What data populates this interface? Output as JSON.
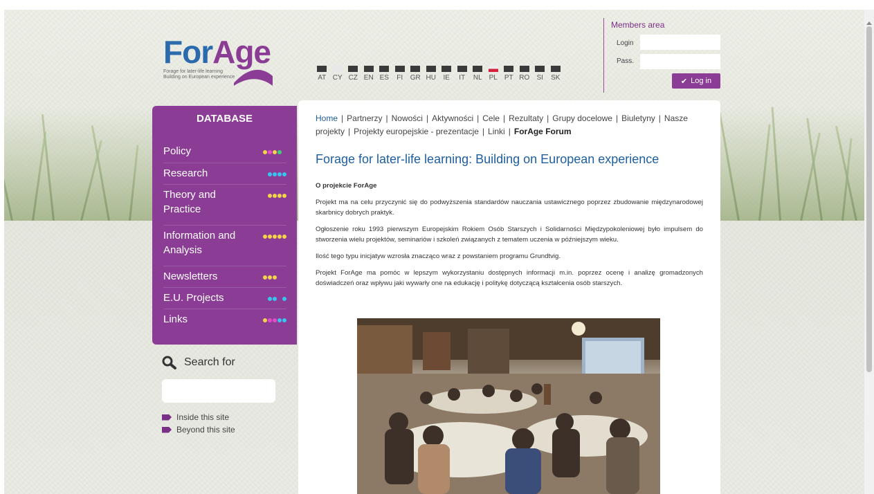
{
  "logo": {
    "part1": "For",
    "part2": "Age",
    "tagline1": "Forage for later-life learning",
    "tagline2": "Building on European experience"
  },
  "languages": [
    "AT",
    "CY",
    "CZ",
    "EN",
    "ES",
    "FI",
    "GR",
    "HU",
    "IE",
    "IT",
    "NL",
    "PL",
    "PT",
    "RO",
    "SI",
    "SK"
  ],
  "members": {
    "title": "Members area",
    "login_label": "Login",
    "pass_label": "Pass.",
    "button": "Log in"
  },
  "database": {
    "title": "DATABASE",
    "items": [
      {
        "label": "Policy",
        "dots": [
          "#f4d44a",
          "#e54bc8",
          "#f4d44a",
          "#39d27a",
          "#8b3d96"
        ]
      },
      {
        "label": "Research",
        "dots": [
          "#8b3d96",
          "#38c6f0",
          "#38c6f0",
          "#38c6f0",
          "#38c6f0"
        ]
      },
      {
        "label": "Theory and Practice",
        "dots": [
          "#8b3d96",
          "#f4d44a",
          "#f4d44a",
          "#f4d44a",
          "#f4d44a"
        ]
      },
      {
        "label": "Information and Analysis",
        "dots": [
          "#f4d44a",
          "#f4d44a",
          "#f4d44a",
          "#f4d44a",
          "#f4d44a"
        ]
      },
      {
        "label": "Newsletters",
        "dots": [
          "#f4d44a",
          "#f4d44a",
          "#f4d44a",
          "#8b3d96",
          "#8b3d96"
        ]
      },
      {
        "label": "E.U. Projects",
        "dots": [
          "#8b3d96",
          "#38c6f0",
          "#38c6f0",
          "#8b3d96",
          "#38c6f0"
        ]
      },
      {
        "label": "Links",
        "dots": [
          "#f4d44a",
          "#e54bc8",
          "#e54bc8",
          "#38c6f0",
          "#38c6f0"
        ]
      }
    ]
  },
  "search": {
    "title": "Search for",
    "inside": "Inside this site",
    "beyond": "Beyond this site"
  },
  "nav": {
    "items": [
      "Home",
      "Partnerzy",
      "Nowości",
      "Aktywności",
      "Cele",
      "Rezultaty",
      "Grupy docelowe",
      "Biuletyny",
      "Nasze projekty",
      "Projekty europejskie - prezentacje",
      "Linki",
      "ForAge Forum"
    ]
  },
  "content": {
    "heading": "Forage for later-life learning: Building on European experience",
    "subheading": "O projekcie ForAge",
    "p1": "Projekt ma na celu przyczynić się do podwyższenia standardów nauczania ustawicznego poprzez zbudowanie międzynarodowej skarbnicy dobrych praktyk.",
    "p2": "Ogłoszenie roku 1993 pierwszym Europejskim Rokiem Osób Starszych i Solidarności Międzypokoleniowej było impulsem do stworzenia wielu projektów, seminariów i szkoleń związanych z tematem uczenia  w późniejszym wieku.",
    "p3": "Ilość tego typu inicjatyw wzrosła znacząco wraz z powstaniem programu Grundtvig.",
    "p4": "Projekt ForAge ma pomóc w lepszym wykorzystaniu dostępnych informacji m.in. poprzez ocenę i analizę gromadzonych doświadczeń oraz wpływu jaki wywarły one na edukację i politykę dotyczącą kształcenia osób starszych."
  }
}
